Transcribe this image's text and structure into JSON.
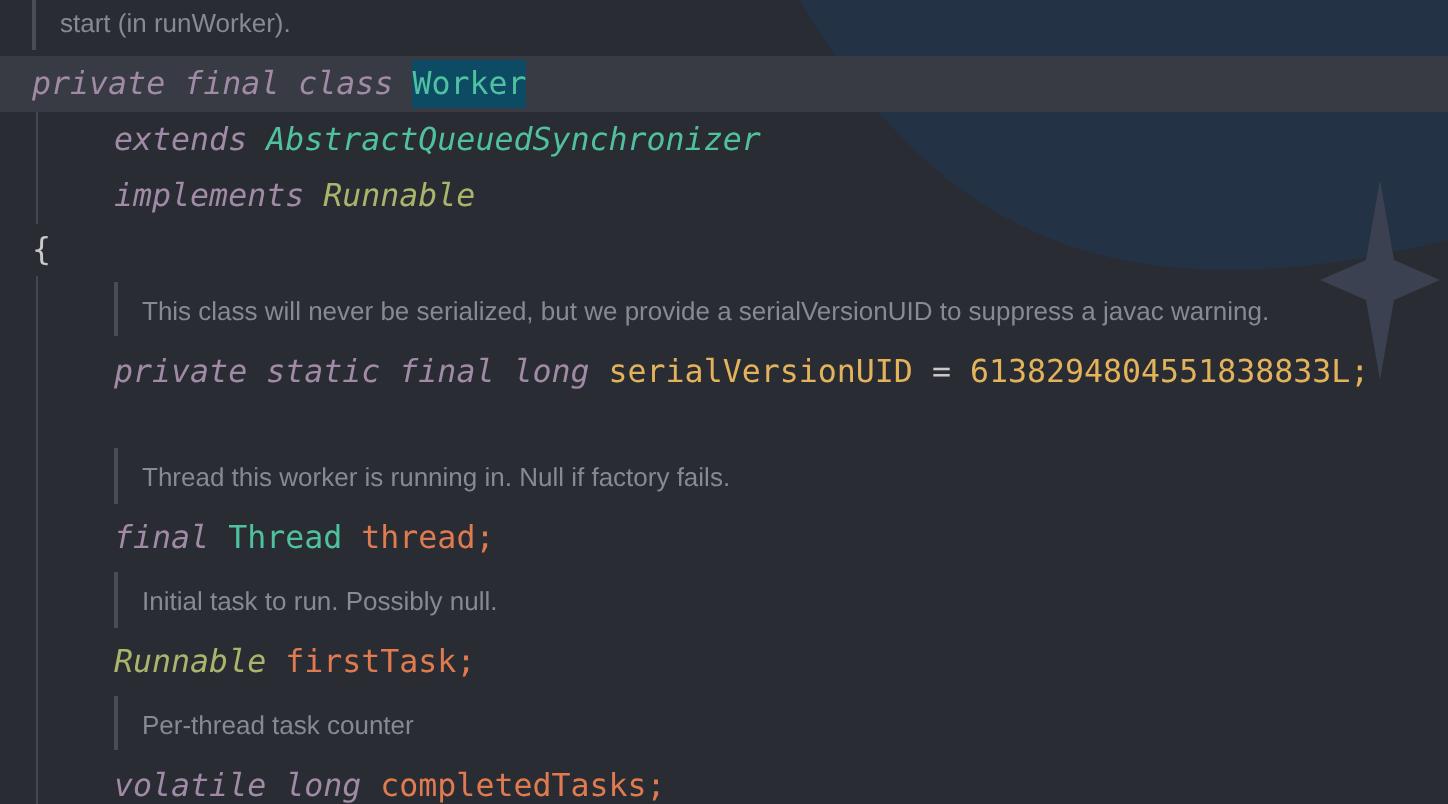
{
  "top_doc": "start (in runWorker).",
  "declaration": [
    {
      "text": "private",
      "kind": "keyword"
    },
    {
      "text": "final",
      "kind": "keyword"
    },
    {
      "text": "class",
      "kind": "keyword"
    },
    {
      "text": "Worker",
      "kind": "class",
      "highlighted": true
    }
  ],
  "clauses": [
    [
      {
        "text": "extends",
        "kind": "keyword"
      },
      {
        "text": "AbstractQueuedSynchronizer",
        "kind": "superclass"
      }
    ],
    [
      {
        "text": "implements",
        "kind": "keyword"
      },
      {
        "text": "Runnable",
        "kind": "interface"
      }
    ]
  ],
  "open_brace": "{",
  "members": [
    {
      "kind": "doc",
      "text": "This class will never be serialized, but we provide a serialVersionUID to suppress a javac warning."
    },
    {
      "kind": "code",
      "tokens": [
        {
          "text": "private",
          "kind": "keyword"
        },
        {
          "text": "static",
          "kind": "keyword"
        },
        {
          "text": "final",
          "kind": "keyword"
        },
        {
          "text": "long",
          "kind": "keyword"
        },
        {
          "text": "serialVersionUID",
          "kind": "constant"
        },
        {
          "text": "=",
          "kind": "punct"
        },
        {
          "text": "6138294804551838833L;",
          "kind": "number"
        }
      ]
    },
    {
      "kind": "gap"
    },
    {
      "kind": "doc",
      "text": "Thread this worker is running in. Null if factory fails."
    },
    {
      "kind": "code",
      "tokens": [
        {
          "text": "final",
          "kind": "keyword"
        },
        {
          "text": "Thread",
          "kind": "class"
        },
        {
          "text": "thread;",
          "kind": "field"
        }
      ]
    },
    {
      "kind": "doc",
      "text": "Initial task to run. Possibly null."
    },
    {
      "kind": "code",
      "tokens": [
        {
          "text": "Runnable",
          "kind": "interface"
        },
        {
          "text": "firstTask;",
          "kind": "field"
        }
      ]
    },
    {
      "kind": "doc",
      "text": "Per-thread task counter"
    },
    {
      "kind": "code",
      "tokens": [
        {
          "text": "volatile",
          "kind": "keyword"
        },
        {
          "text": "long",
          "kind": "keyword"
        },
        {
          "text": "completedTasks;",
          "kind": "field"
        }
      ]
    }
  ]
}
